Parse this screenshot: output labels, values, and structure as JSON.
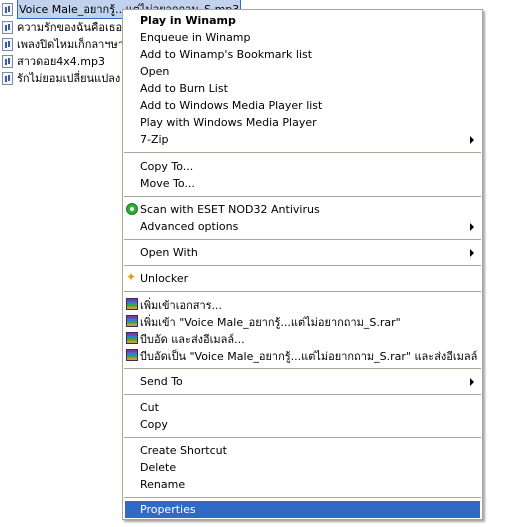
{
  "files": [
    {
      "name": "Voice Male_อยากรู้...แต่ไม่อยากถาม_S.mp3",
      "selected": true
    },
    {
      "name": "ความรักของฉันคือเธอ"
    },
    {
      "name": "เพลงปิดไหมเก็กลาฯษาย"
    },
    {
      "name": "สาวดอย4x4.mp3"
    },
    {
      "name": "รักไม่ยอมเปลี่ยนแปลง"
    }
  ],
  "menu": {
    "play": "Play in Winamp",
    "enqueue": "Enqueue in Winamp",
    "bookmark": "Add to Winamp's Bookmark list",
    "open": "Open",
    "burn": "Add to Burn List",
    "wmp_list": "Add to Windows Media Player list",
    "wmp_play": "Play with Windows Media Player",
    "zip": "7-Zip",
    "copy_to": "Copy To...",
    "move_to": "Move To...",
    "eset": "Scan with ESET NOD32 Antivirus",
    "advanced": "Advanced options",
    "open_with": "Open With",
    "unlocker": "Unlocker",
    "rar_add": "เพิ่มเข้าเอกสาร...",
    "rar_add_named": "เพิ่มเข้า \"Voice Male_อยากรู้...แต่ไม่อยากถาม_S.rar\"",
    "rar_email": "บีบอัด และส่งอีเมลล์...",
    "rar_email_named": "บีบอัดเป็น \"Voice Male_อยากรู้...แต่ไม่อยากถาม_S.rar\" และส่งอีเมลล์",
    "send_to": "Send To",
    "cut": "Cut",
    "copy": "Copy",
    "create_shortcut": "Create Shortcut",
    "delete": "Delete",
    "rename": "Rename",
    "properties": "Properties"
  },
  "colors": {
    "highlight": "#316ac5",
    "menu_border": "#aca899"
  }
}
